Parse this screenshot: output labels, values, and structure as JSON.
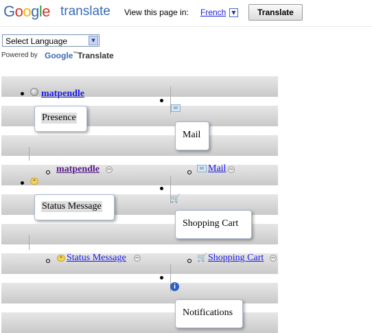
{
  "translate_bar": {
    "logo_g": "G",
    "logo_o1": "o",
    "logo_o2": "o",
    "logo_g2": "g",
    "logo_l": "l",
    "logo_e": "e",
    "logo_word": "translate",
    "view_text": "View this page in:",
    "language_link": "French",
    "translate_button": "Translate",
    "colors": {
      "blue": "#3a6bb4",
      "red": "#d0322a",
      "yellow": "#f0b400",
      "green": "#2e9a3c"
    }
  },
  "language_select": {
    "value": "Select Language"
  },
  "powered_by": {
    "text": "Powered by",
    "google": "Google",
    "trademark": "™",
    "translate": "Translate"
  },
  "users": {
    "name": "matpendle"
  },
  "status": {
    "presence_tip": "Presence",
    "mail_tip": "Mail",
    "status_message_tip": "Status Message",
    "shopping_cart_tip": "Shopping Cart",
    "notifications_tip": "Notifications"
  },
  "links": {
    "mail": "Mail",
    "status_message": "Status Message",
    "shopping_cart": "Shopping Cart"
  },
  "icons": {
    "collapse": "−",
    "info": "i",
    "cart": "🛒",
    "mail": "✉",
    "bubble": "❝"
  }
}
